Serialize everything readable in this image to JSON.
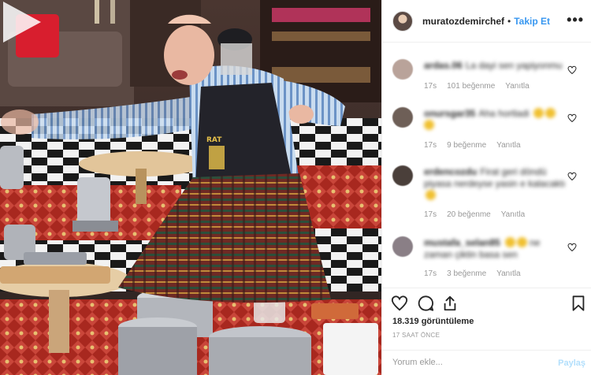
{
  "header": {
    "username": "muratozdemirchef",
    "separator": "•",
    "follow_label": "Takip Et",
    "more_label": "•••"
  },
  "apron_text": "RAT",
  "comments": [
    {
      "user": "ardas.06",
      "text": "La dayi sen yapiyonmu",
      "time": "17s",
      "likes": "101 beğenme",
      "reply": "Yanıtla",
      "avatar_color": "#b9a39a"
    },
    {
      "user": "onursgar35",
      "text": "Aha hortladi",
      "time": "17s",
      "likes": "9 beğenme",
      "reply": "Yanıtla",
      "avatar_color": "#6e5f57"
    },
    {
      "user": "erdencozdu",
      "text": "Firat geri döndü piyasa nerdeyse yasin e kalacaktı",
      "time": "17s",
      "likes": "20 beğenme",
      "reply": "Yanıtla",
      "avatar_color": "#4a3f3a"
    },
    {
      "user": "mustafa_selan85",
      "text": "ne zaman çiktin basa sen",
      "time": "17s",
      "likes": "3 beğenme",
      "reply": "Yanıtla",
      "avatar_color": "#8a7f86"
    }
  ],
  "actions": {
    "like_icon": "heart-icon",
    "comment_icon": "comment-icon",
    "share_icon": "share-icon",
    "save_icon": "bookmark-icon"
  },
  "views": "18.319 görüntüleme",
  "time_ago": "17 SAAT ÖNCE",
  "add_comment": {
    "placeholder": "Yorum ekle...",
    "submit_label": "Paylaş"
  }
}
